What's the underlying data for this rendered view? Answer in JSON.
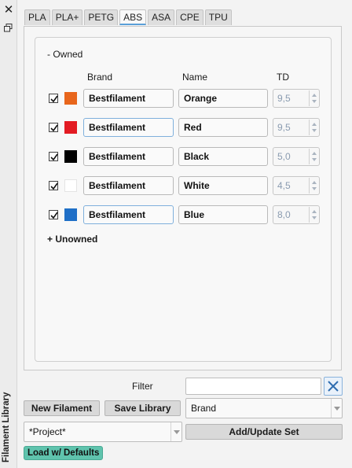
{
  "dock": {
    "title": "Filament Library",
    "close_icon": "close-icon",
    "float_icon": "float-window-icon"
  },
  "tabs": [
    {
      "label": "PLA",
      "active": false
    },
    {
      "label": "PLA+",
      "active": false
    },
    {
      "label": "PETG",
      "active": false
    },
    {
      "label": "ABS",
      "active": true
    },
    {
      "label": "ASA",
      "active": false
    },
    {
      "label": "CPE",
      "active": false
    },
    {
      "label": "TPU",
      "active": false
    }
  ],
  "owned_section": {
    "label": "- Owned"
  },
  "unowned_section": {
    "label": "+ Unowned"
  },
  "columns": {
    "brand": "Brand",
    "name": "Name",
    "td": "TD"
  },
  "filaments": [
    {
      "checked": true,
      "color": "#e8661c",
      "brand": "Bestfilament",
      "name": "Orange",
      "td": "9,5"
    },
    {
      "checked": true,
      "color": "#e31b23",
      "brand": "Bestfilament",
      "name": "Red",
      "td": "9,5"
    },
    {
      "checked": true,
      "color": "#000000",
      "brand": "Bestfilament",
      "name": "Black",
      "td": "5,0"
    },
    {
      "checked": true,
      "color": "#ffffff",
      "brand": "Bestfilament",
      "name": "White",
      "td": "4,5"
    },
    {
      "checked": true,
      "color": "#1f6fc7",
      "brand": "Bestfilament",
      "name": "Blue",
      "td": "8,0"
    }
  ],
  "filter": {
    "label": "Filter",
    "value": "",
    "clear_icon": "clear-x-icon"
  },
  "buttons": {
    "new_filament": "New Filament",
    "save_library": "Save Library",
    "add_update_set": "Add/Update Set",
    "load_defaults": "Load w/ Defaults"
  },
  "sort_select": {
    "value": "Brand"
  },
  "project_select": {
    "value": "*Project*"
  }
}
